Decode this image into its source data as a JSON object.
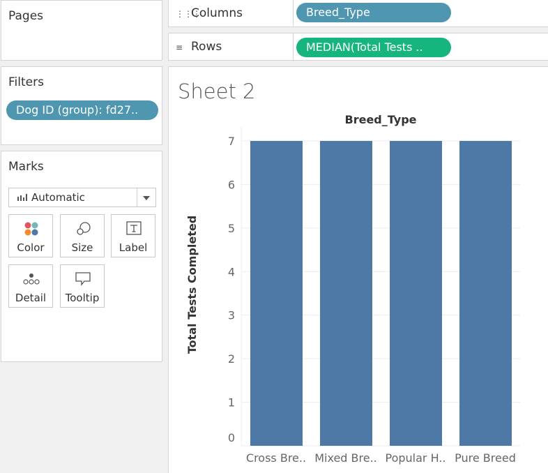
{
  "pages": {
    "title": "Pages"
  },
  "filters": {
    "title": "Filters",
    "pill": "Dog ID (group): fd27.."
  },
  "marks": {
    "title": "Marks",
    "type_selected": "Automatic",
    "buttons": [
      {
        "label": "Color",
        "icon": "color-icon"
      },
      {
        "label": "Size",
        "icon": "size-icon"
      },
      {
        "label": "Label",
        "icon": "label-icon"
      },
      {
        "label": "Detail",
        "icon": "detail-icon"
      },
      {
        "label": "Tooltip",
        "icon": "tooltip-icon"
      }
    ]
  },
  "shelves": {
    "columns_label": "Columns",
    "columns_pill": "Breed_Type",
    "rows_label": "Rows",
    "rows_pill": "MEDIAN(Total Tests .."
  },
  "sheet": {
    "title": "Sheet 2"
  },
  "colors": {
    "bar": "#4e79a7",
    "dimension_pill": "#4f96b0",
    "measure_pill": "#16b57e"
  },
  "chart_data": {
    "type": "bar",
    "title": "Breed_Type",
    "categories": [
      "Cross Bre..",
      "Mixed Bre..",
      "Popular H..",
      "Pure Breed"
    ],
    "values": [
      7,
      7,
      7,
      7
    ],
    "xlabel": "",
    "ylabel": "Total Tests Completed",
    "ylim": [
      0,
      7
    ],
    "yticks": [
      0,
      1,
      2,
      3,
      4,
      5,
      6,
      7
    ],
    "grid": true
  }
}
